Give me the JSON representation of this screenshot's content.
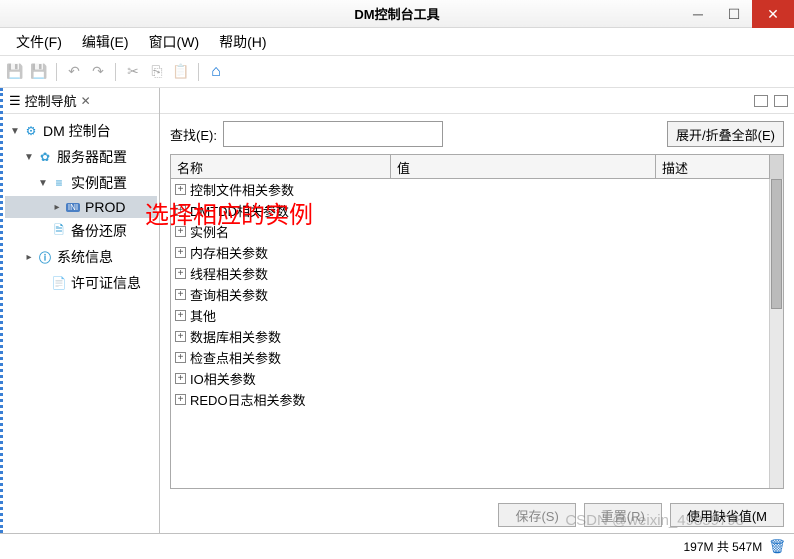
{
  "window": {
    "title": "DM控制台工具"
  },
  "menu": {
    "file": "文件(F)",
    "edit": "编辑(E)",
    "window": "窗口(W)",
    "help": "帮助(H)"
  },
  "nav": {
    "title": "控制导航",
    "tree": {
      "root": "DM 控制台",
      "server_config": "服务器配置",
      "instance_config": "实例配置",
      "prod": "PROD",
      "backup_restore": "备份还原",
      "system_info": "系统信息",
      "license_info": "许可证信息"
    }
  },
  "main": {
    "search_label": "查找(E):",
    "search_value": "",
    "expand_btn": "展开/折叠全部(E)",
    "columns": {
      "name": "名称",
      "value": "值",
      "desc": "描述"
    },
    "params": [
      "控制文件相关参数",
      "DMTDD相关参数",
      "实例名",
      "内存相关参数",
      "线程相关参数",
      "查询相关参数",
      "其他",
      "数据库相关参数",
      "检查点相关参数",
      "IO相关参数",
      "REDO日志相关参数"
    ],
    "buttons": {
      "save": "保存(S)",
      "reset": "重置(R)",
      "default": "使用缺省值(M"
    }
  },
  "status": {
    "mem": "197M 共 547M"
  },
  "overlay": "选择相应的实例",
  "watermark": "CSDN @weixin_49859798"
}
